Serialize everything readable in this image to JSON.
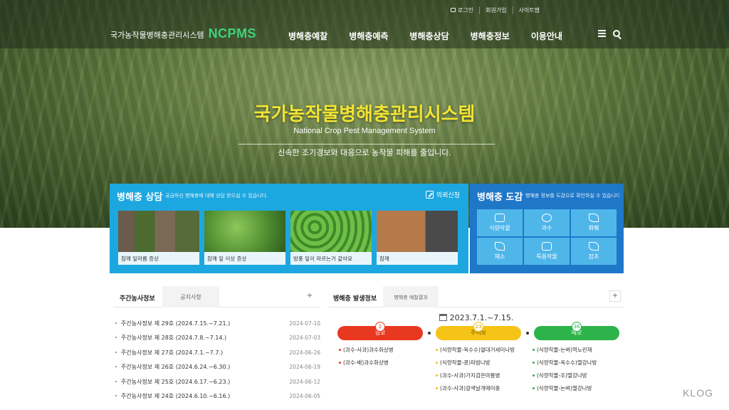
{
  "header": {
    "util": [
      "로그인",
      "회원가입",
      "사이트맵"
    ],
    "logo_ko": "국가농작물병해충관리시스템",
    "logo_en": "NCPMS",
    "nav": [
      "병해충예찰",
      "병해충예측",
      "병해충상담",
      "병해충정보",
      "이용안내"
    ]
  },
  "hero": {
    "title": "국가농작물병해충관리시스템",
    "subtitle": "National Crop Pest Management System",
    "desc": "신속한 조기경보와 대응으로 농작물 피해를 줄입니다."
  },
  "consult": {
    "title": "병해충 상담",
    "note": "궁금하신 병해충에 대해 상담 받으실 수 있습니다.",
    "apply": "의뢰신청",
    "cards": [
      {
        "caption": "참깨 잎마름 증상"
      },
      {
        "caption": "참깨 잎 이상 증상"
      },
      {
        "caption": "방풍 잎이 마르는거 같아요"
      },
      {
        "caption": "참깨"
      }
    ]
  },
  "dict": {
    "title": "병해충 도감",
    "note": "병해충 정보를 도감으로 확인하실 수 있습니다.",
    "items": [
      {
        "label": "식량작물",
        "icon": "grain-icon"
      },
      {
        "label": "과수",
        "icon": "apple-icon"
      },
      {
        "label": "화훼",
        "icon": "flower-icon"
      },
      {
        "label": "채소",
        "icon": "vegetable-icon"
      },
      {
        "label": "특용작물",
        "icon": "special-crop-icon"
      },
      {
        "label": "잡초",
        "icon": "weed-icon"
      }
    ]
  },
  "weekly": {
    "tab_active": "주간농사정보",
    "tab_other": "공지사항",
    "plus": "+",
    "rows": [
      {
        "title": "주간농사정보 제 29호 (2024.7.15.~7.21.)",
        "date": "2024-07-10"
      },
      {
        "title": "주간농사정보 제 28호 (2024.7.8.~7.14.)",
        "date": "2024-07-03"
      },
      {
        "title": "주간농사정보 제 27호 (2024.7.1.~7.7.)",
        "date": "2024-06-26"
      },
      {
        "title": "주간농사정보 제 26호 (2024.6.24.~6.30.)",
        "date": "2024-06-19"
      },
      {
        "title": "주간농사정보 제 25호 (2024.6.17.~6.23.)",
        "date": "2024-06-12"
      },
      {
        "title": "주간농사정보 제 24호 (2024.6.10.~6.16.)",
        "date": "2024-06-05"
      }
    ]
  },
  "occurrence": {
    "tab_active": "병해충 발생정보",
    "tab_other": "병해충 예찰결과",
    "plus": "+",
    "period": "2023.7.1.~7.15.",
    "levels": [
      {
        "label": "경보",
        "count": "2"
      },
      {
        "label": "주의보",
        "count": "23"
      },
      {
        "label": "예보",
        "count": "36"
      }
    ],
    "alert": [
      "(과수-사과)과수화상병",
      "(과수-배)과수화상병"
    ],
    "caution": [
      "(식량작물-옥수수)열대거세미나방",
      "(식량작물-콩)파밤나방",
      "(과수-사과)가지검은마름병",
      "(과수-사과)갈색날개매미충"
    ],
    "forecast": [
      "(식량작물-논벼)먹노린재",
      "(식량작물-옥수수)멸강나방",
      "(식량작물-조)멸강나방",
      "(식량작물-논벼)멸강나방"
    ]
  },
  "watermark": "KLOG"
}
